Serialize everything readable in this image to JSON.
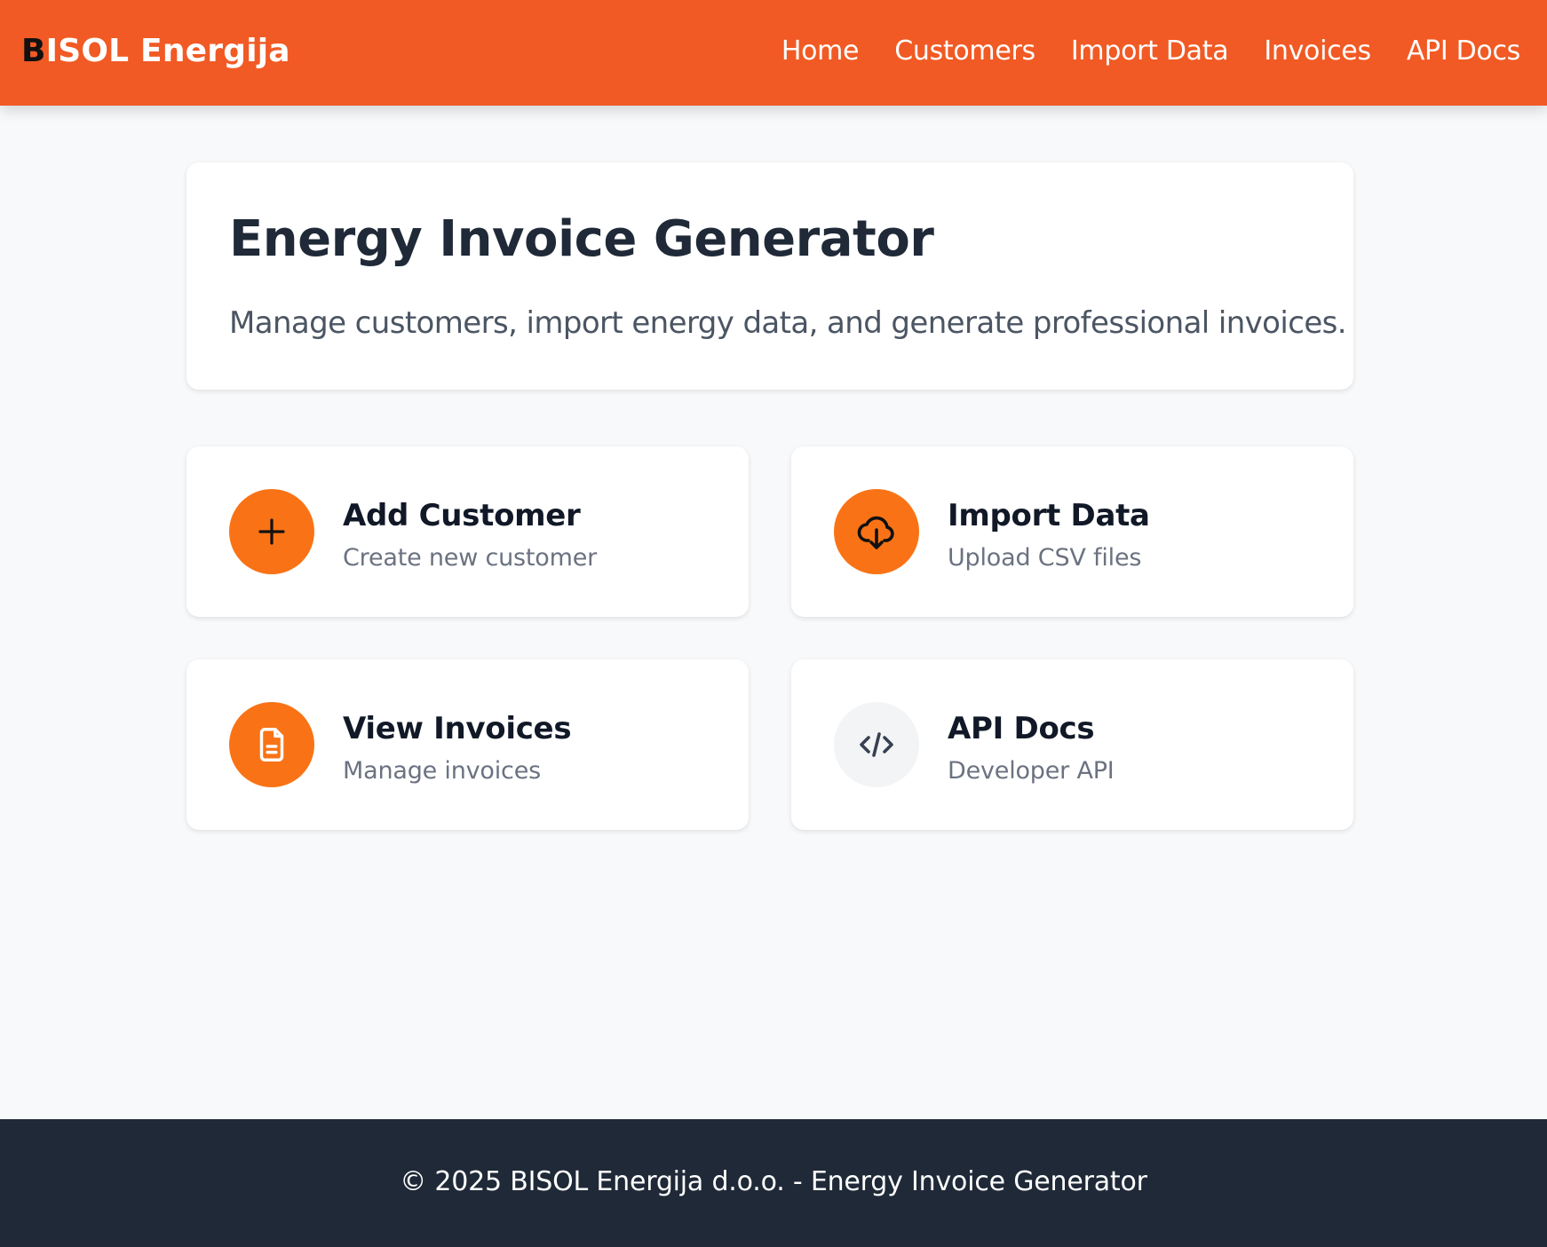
{
  "navbar": {
    "brand_first": "B",
    "brand_rest": "ISOL Energija",
    "links": [
      "Home",
      "Customers",
      "Import Data",
      "Invoices",
      "API Docs"
    ]
  },
  "hero": {
    "title": "Energy Invoice Generator",
    "subtitle": "Manage customers, import energy data, and generate professional invoices."
  },
  "cards": [
    {
      "title": "Add Customer",
      "subtitle": "Create new customer",
      "icon": "plus-icon"
    },
    {
      "title": "Import Data",
      "subtitle": "Upload CSV files",
      "icon": "cloud-download-icon"
    },
    {
      "title": "View Invoices",
      "subtitle": "Manage invoices",
      "icon": "document-icon"
    },
    {
      "title": "API Docs",
      "subtitle": "Developer API",
      "icon": "code-icon"
    }
  ],
  "footer": {
    "text": "© 2025 BISOL Energija d.o.o. - Energy Invoice Generator"
  },
  "colors": {
    "brand": "#f15a24",
    "accent": "#f97316",
    "footer_bg": "#1f2937",
    "page_bg": "#f8f9fb"
  }
}
